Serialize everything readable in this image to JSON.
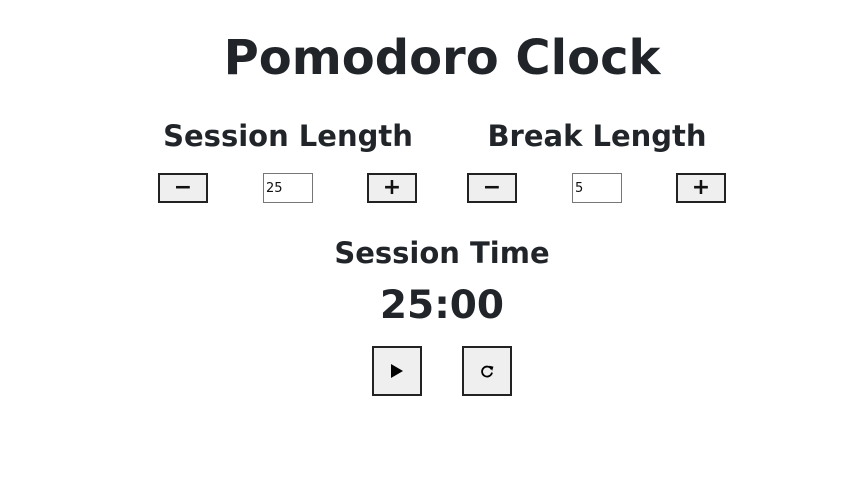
{
  "app": {
    "title": "Pomodoro Clock"
  },
  "session": {
    "label": "Session Length",
    "decrement_label": "−",
    "increment_label": "+",
    "value": "25"
  },
  "break": {
    "label": "Break Length",
    "decrement_label": "−",
    "increment_label": "+",
    "value": "5"
  },
  "timer": {
    "label": "Session Time",
    "time": "25:00"
  },
  "actions": {
    "play_icon": "play-icon",
    "reset_icon": "reset-icon"
  },
  "colors": {
    "text": "#212529",
    "button_bg": "#efefef",
    "button_border": "#222222"
  }
}
